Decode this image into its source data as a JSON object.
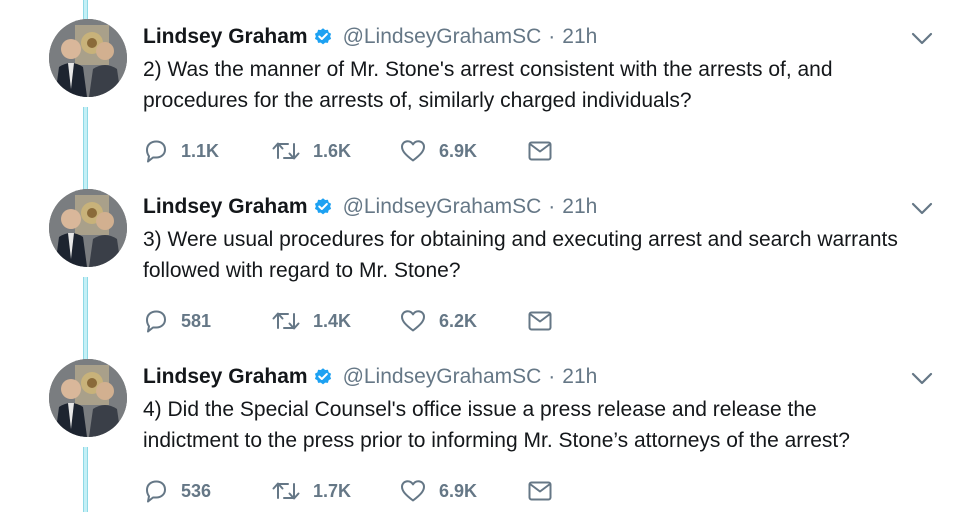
{
  "colors": {
    "name": "#14171a",
    "muted": "#657786",
    "verified": "#1da1f2",
    "thread_line": "#c4f0f6"
  },
  "icons": {
    "verified": "verified-badge-icon",
    "caret": "chevron-down-icon",
    "reply": "reply-icon",
    "retweet": "retweet-icon",
    "like": "heart-icon",
    "dm": "envelope-icon"
  },
  "tweets": [
    {
      "name": "Lindsey Graham",
      "handle": "@LindseyGrahamSC",
      "separator": "·",
      "time": "21h",
      "lines": [
        "2) Was the manner of Mr. Stone's arrest consistent with the arrests of, and",
        "procedures for the arrests of, similarly charged individuals?"
      ],
      "replies": "1.1K",
      "retweets": "1.6K",
      "likes": "6.9K"
    },
    {
      "name": "Lindsey Graham",
      "handle": "@LindseyGrahamSC",
      "separator": "·",
      "time": "21h",
      "lines": [
        "3) Were usual procedures for obtaining and executing arrest and search warrants",
        "followed with regard to Mr. Stone?"
      ],
      "replies": "581",
      "retweets": "1.4K",
      "likes": "6.2K"
    },
    {
      "name": "Lindsey Graham",
      "handle": "@LindseyGrahamSC",
      "separator": "·",
      "time": "21h",
      "lines": [
        "4) Did the Special Counsel's office issue a press release and release the",
        "indictment to the press prior to informing Mr. Stone’s attorneys of the arrest?"
      ],
      "replies": "536",
      "retweets": "1.7K",
      "likes": "6.9K"
    }
  ]
}
